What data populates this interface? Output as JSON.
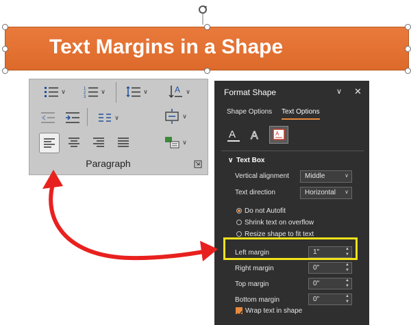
{
  "slide": {
    "shape_title": "Text Margins in a Shape",
    "shape_color": "#e2703a"
  },
  "paragraph_group": {
    "label": "Paragraph",
    "buttons": [
      "bullets",
      "numbering",
      "line-spacing",
      "text-direction",
      "decrease-indent",
      "increase-indent",
      "columns",
      "align-text",
      "align-left",
      "center",
      "align-right",
      "justify",
      "smartart-convert"
    ]
  },
  "format_pane": {
    "title": "Format Shape",
    "tabs": [
      "Shape Options",
      "Text Options"
    ],
    "active_tab": "Text Options",
    "section": "Text Box",
    "vertical_alignment": {
      "label": "Vertical alignment",
      "value": "Middle"
    },
    "text_direction": {
      "label": "Text direction",
      "value": "Horizontal"
    },
    "autofit": [
      {
        "label": "Do not Autofit",
        "selected": true
      },
      {
        "label": "Shrink text on overflow",
        "selected": false
      },
      {
        "label": "Resize shape to fit text",
        "selected": false
      }
    ],
    "margins": [
      {
        "label": "Left margin",
        "value": "1\""
      },
      {
        "label": "Right margin",
        "value": "0\""
      },
      {
        "label": "Top margin",
        "value": "0\""
      },
      {
        "label": "Bottom margin",
        "value": "0\""
      }
    ],
    "wrap_text": {
      "label": "Wrap text in shape",
      "checked": true
    },
    "highlight_color": "#f2e21b",
    "accent_color": "#e9893c"
  },
  "annotation": {
    "arrow_color": "#e8211f"
  }
}
